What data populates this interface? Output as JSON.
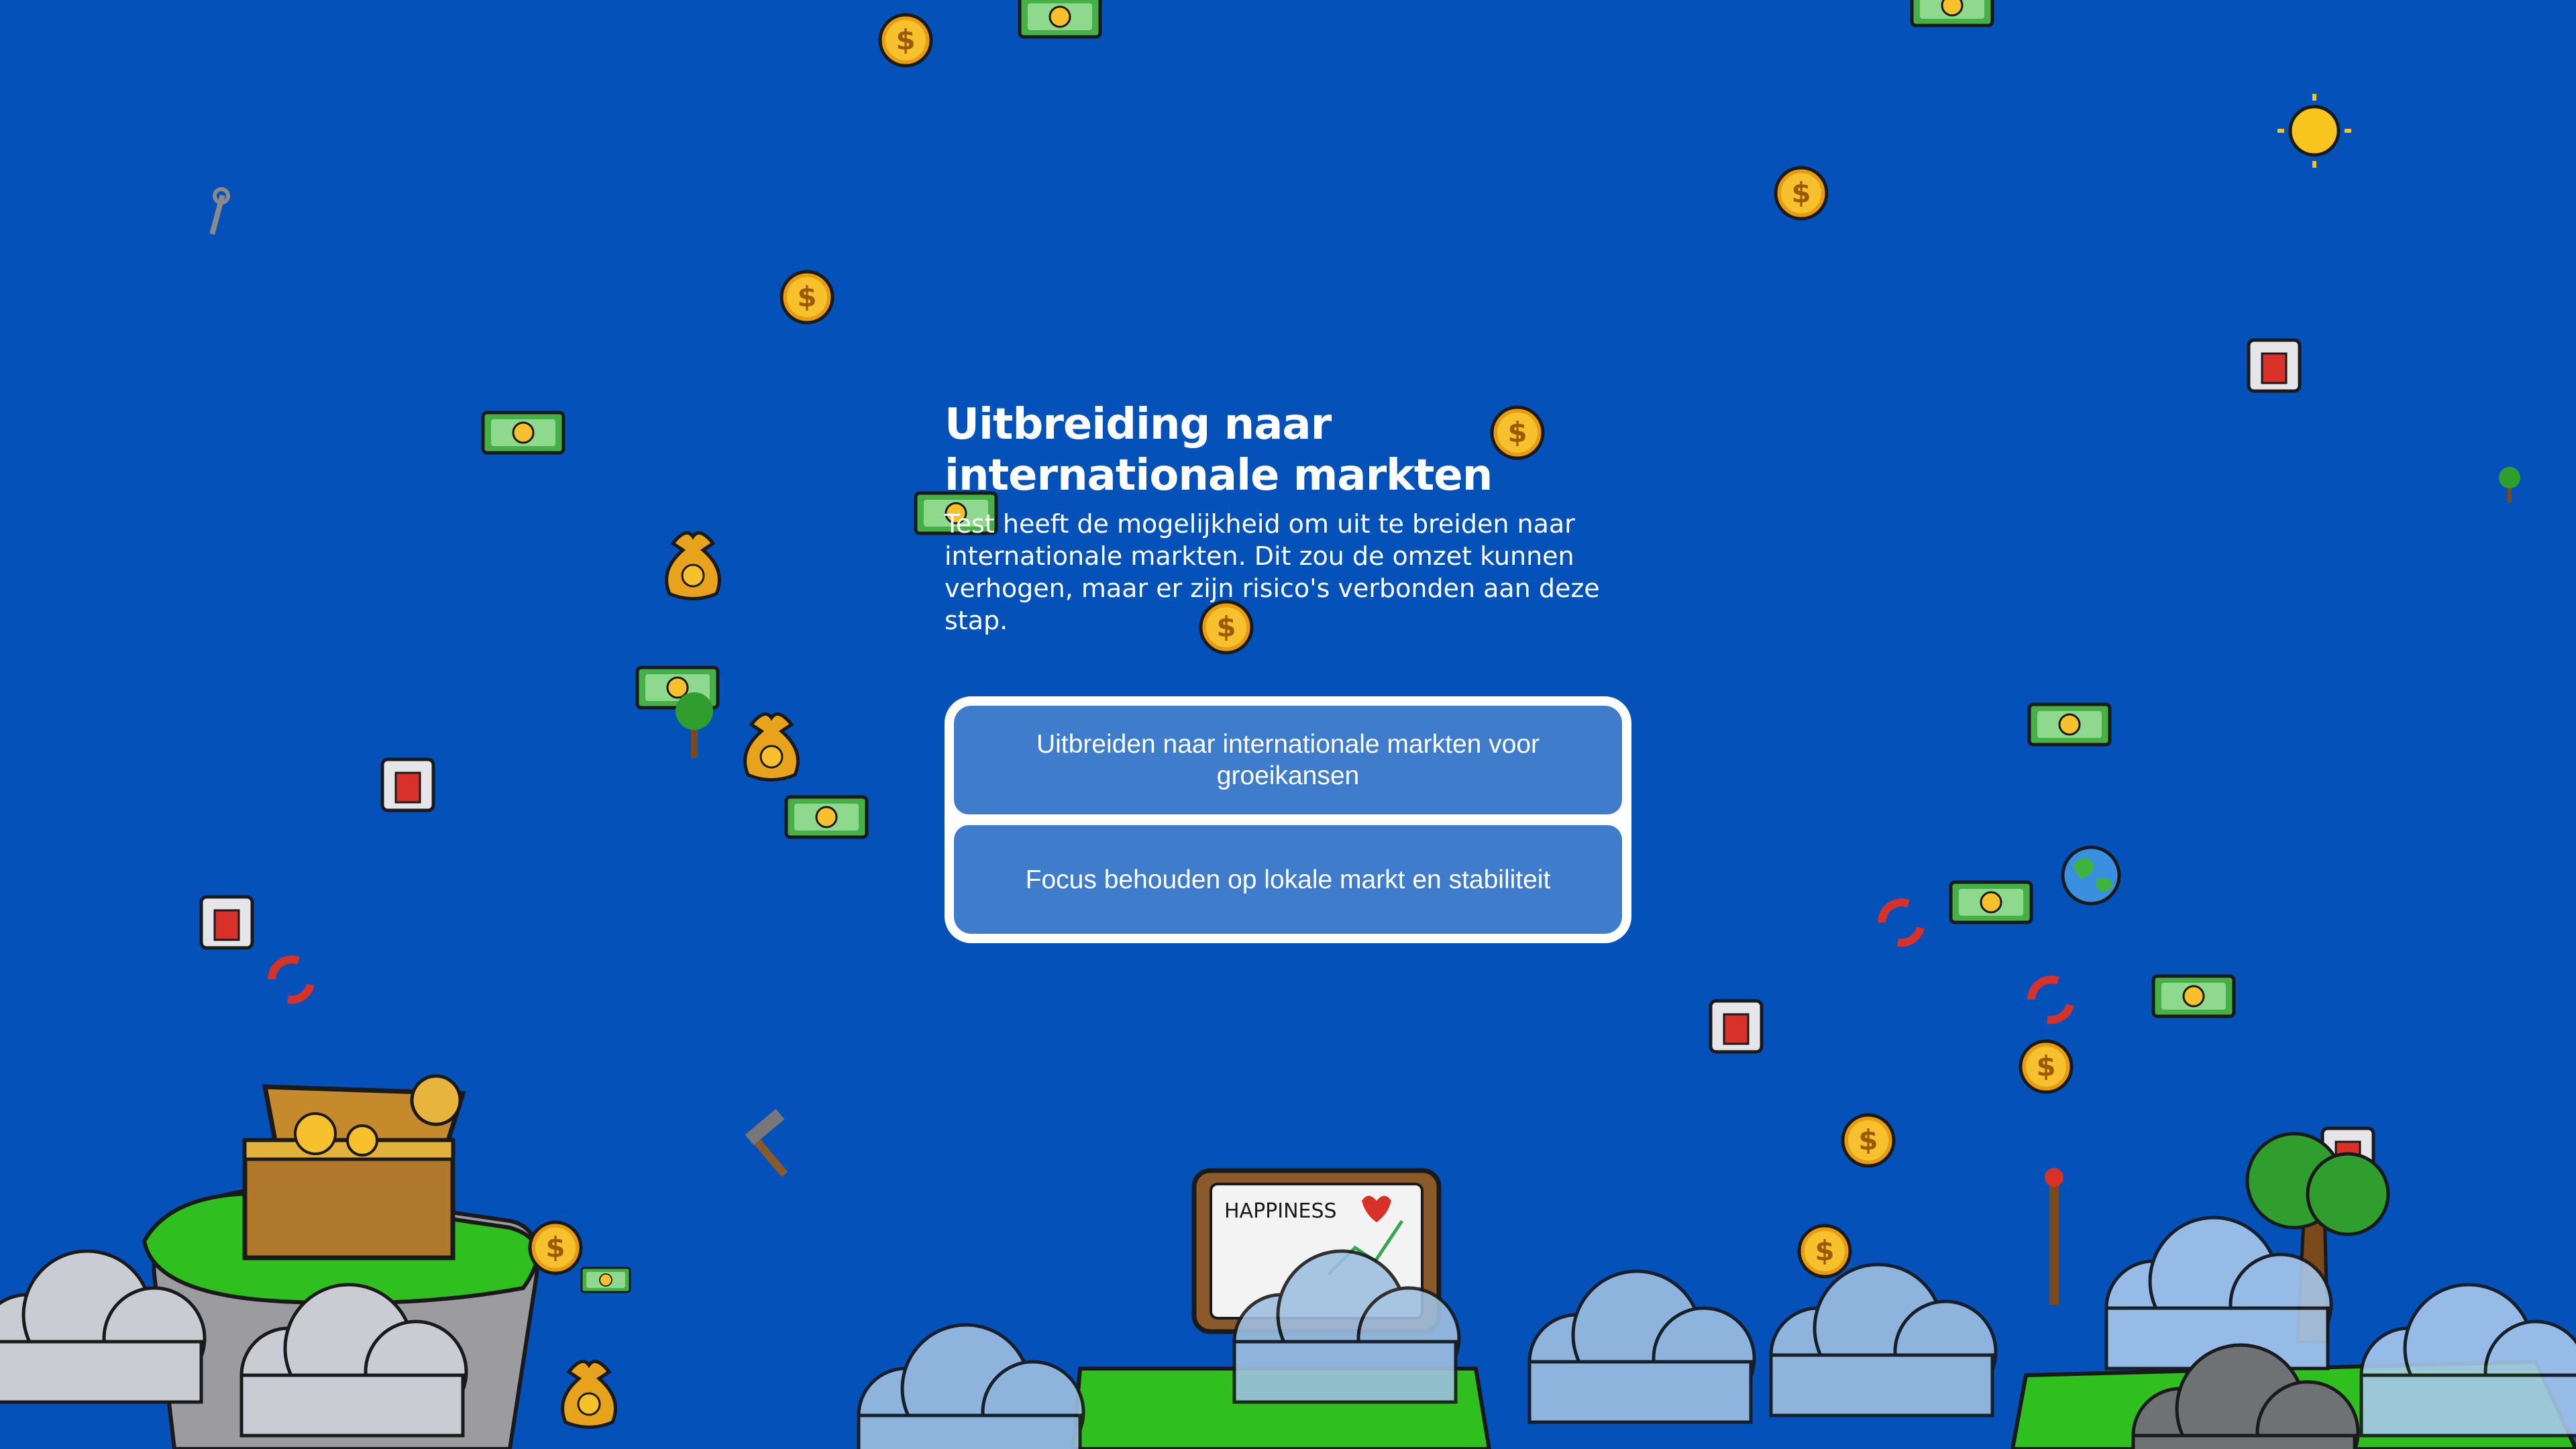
{
  "dialog": {
    "title": "Uitbreiding naar internationale markten",
    "description": "Test heeft de mogelijkheid om uit te breiden naar internationale markten. Dit zou de omzet kunnen verhogen, maar er zijn risico's verbonden aan deze stap.",
    "options": [
      {
        "label": "Uitbreiden naar internationale markten voor groeikansen"
      },
      {
        "label": "Focus behouden op lokale markt en stabiliteit"
      }
    ]
  },
  "scene": {
    "sign_text": "HAPPINESS",
    "icons": [
      "coin-icon",
      "banknote-icon",
      "money-bag-icon",
      "calendar-icon",
      "recycle-icon",
      "globe-icon",
      "sun-icon",
      "tree-icon",
      "wrench-icon",
      "hammer-icon",
      "treasure-chest-icon",
      "cloud-icon",
      "happiness-sign-icon",
      "island-icon"
    ]
  },
  "colors": {
    "background": "#0452b9",
    "button": "#3f7ccb",
    "button_border": "#ffffff",
    "text": "#ffffff",
    "coin": "#f2b418",
    "banknote": "#3aa63a",
    "grass": "#2fbf1f",
    "cloud": "#c8ccd4"
  }
}
